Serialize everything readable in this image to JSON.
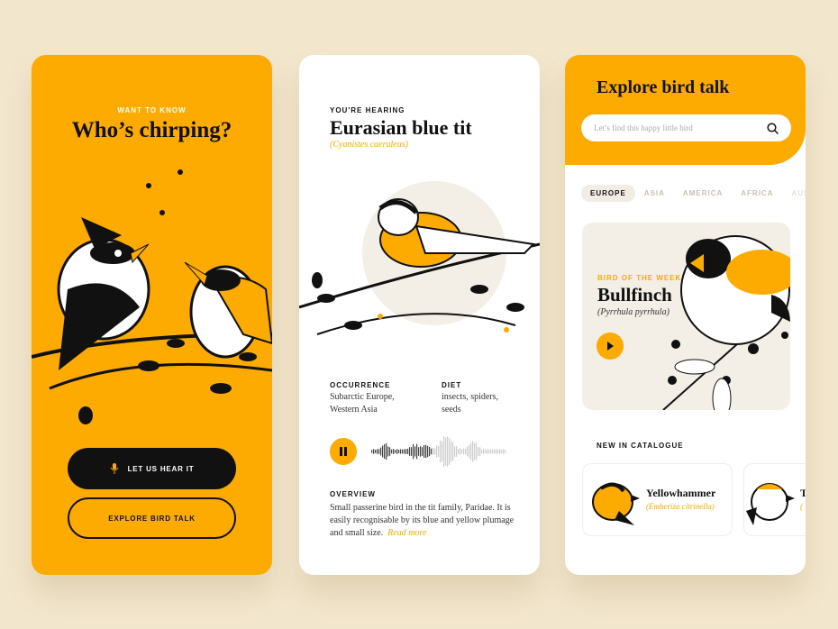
{
  "colors": {
    "accent": "#fdab00",
    "background": "#f2e6cd",
    "dark": "#111111",
    "card": "#f3efe7"
  },
  "screen1": {
    "eyebrow": "WANT TO KNOW",
    "title": "Who’s chirping?",
    "primary_button": "LET US HEAR IT",
    "primary_icon": "microphone-icon",
    "secondary_button": "EXPLORE BIRD TALK"
  },
  "screen2": {
    "eyebrow": "YOU'RE HEARING",
    "title": "Eurasian blue tit",
    "latin": "(Cyanistes caeruleus)",
    "occurrence": {
      "label": "OCCURRENCE",
      "value": "Subarctic Europe, Western Asia"
    },
    "diet": {
      "label": "DIET",
      "value": "insects, spiders, seeds"
    },
    "player": {
      "state": "playing",
      "icon": "pause-icon",
      "progress": 0.45
    },
    "overview": {
      "label": "OVERVIEW",
      "text": "Small passerine bird in the tit family, Paridae. It is easily recognisable by its blue and yellow plumage and small size.",
      "read_more": "Read more"
    }
  },
  "screen3": {
    "title": "Explore bird talk",
    "search": {
      "placeholder": "Let’s find this happy little bird",
      "icon": "search-icon"
    },
    "tabs": [
      {
        "label": "EUROPE",
        "active": true
      },
      {
        "label": "ASIA"
      },
      {
        "label": "AMERICA"
      },
      {
        "label": "AFRICA"
      },
      {
        "label": "AUSTRALIA"
      }
    ],
    "featured": {
      "eyebrow": "BIRD OF THE WEEK",
      "name": "Bullfinch",
      "latin": "(Pyrrhula pyrrhula)",
      "icon": "play-icon"
    },
    "catalogue": {
      "label": "NEW IN CATALOGUE",
      "items": [
        {
          "name": "Yellowhammer",
          "latin": "(Emberiza citrinella)"
        },
        {
          "name": "T",
          "latin": "("
        }
      ]
    }
  }
}
